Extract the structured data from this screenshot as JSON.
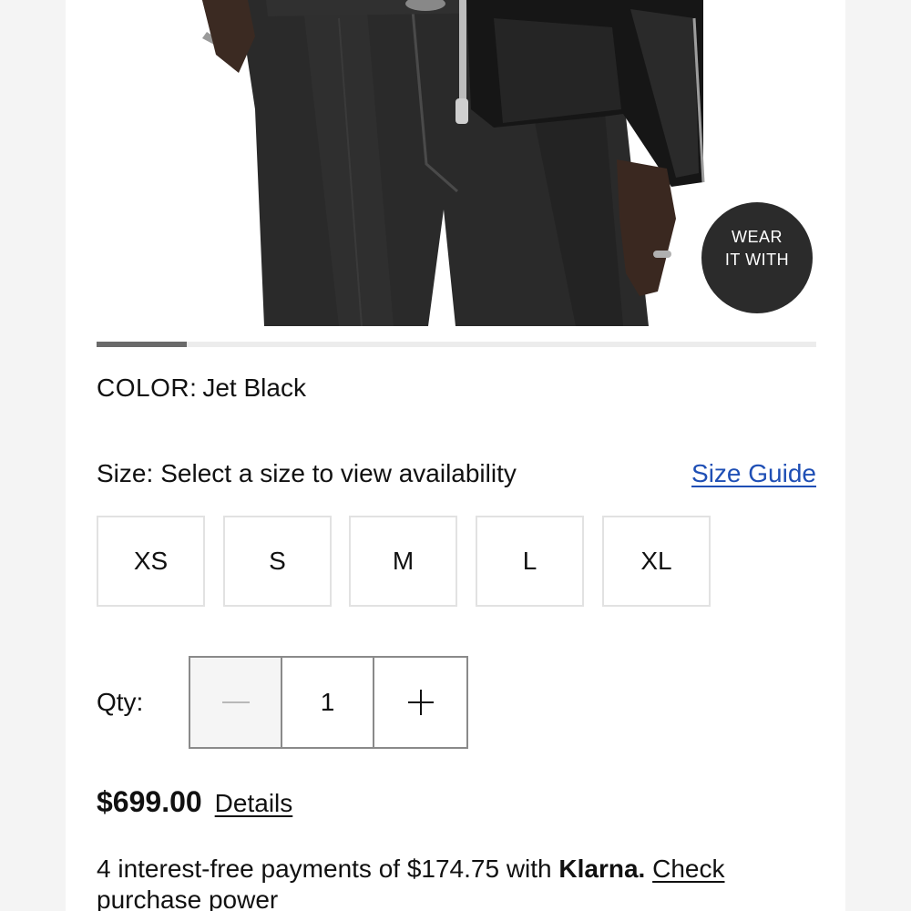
{
  "product_image": {
    "overlay_button": {
      "line1": "WEAR",
      "line2": "IT WITH"
    },
    "carousel_progress": 0.125
  },
  "color": {
    "label": "COLOR:",
    "value": "Jet Black"
  },
  "size": {
    "label": "Size:",
    "message": "Select a size to view availability",
    "guide_link": "Size Guide",
    "options": [
      "XS",
      "S",
      "M",
      "L",
      "XL"
    ]
  },
  "quantity": {
    "label": "Qty:",
    "value": "1"
  },
  "price": {
    "amount": "$699.00",
    "details_link": "Details"
  },
  "klarna": {
    "text": "4 interest-free payments of $174.75 with ",
    "brand": "Klarna.",
    "link": "Check purchase power"
  },
  "colors": {
    "accent_link": "#1f4fb5",
    "overlay_bg": "#2b2b2b",
    "border_light": "#e2e2e2",
    "border_dark": "#8a8a8a"
  }
}
